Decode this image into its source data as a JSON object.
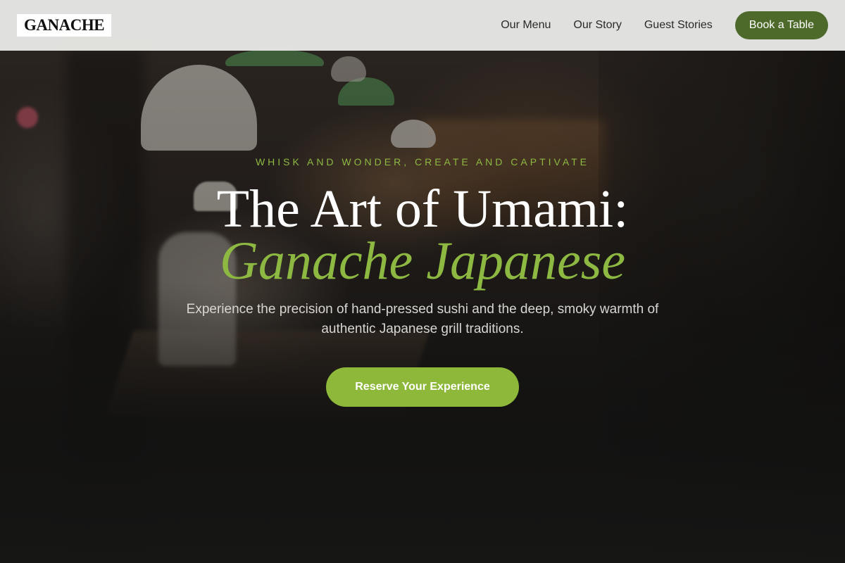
{
  "header": {
    "logo": "GANACHE",
    "nav": [
      {
        "label": "Our Menu"
      },
      {
        "label": "Our Story"
      },
      {
        "label": "Guest Stories"
      }
    ],
    "book_button": "Book a Table"
  },
  "hero": {
    "tagline": "WHISK AND WONDER, CREATE AND CAPTIVATE",
    "title_line1": "The Art of Umami:",
    "title_line2": "Ganache Japanese",
    "subtitle": "Experience the precision of hand-pressed sushi and the deep, smoky warmth of authentic Japanese grill traditions.",
    "cta": "Reserve Your Experience"
  },
  "colors": {
    "accent_green": "#8db842",
    "button_dark_green": "#4e6a2b",
    "header_bg": "#ececea"
  }
}
